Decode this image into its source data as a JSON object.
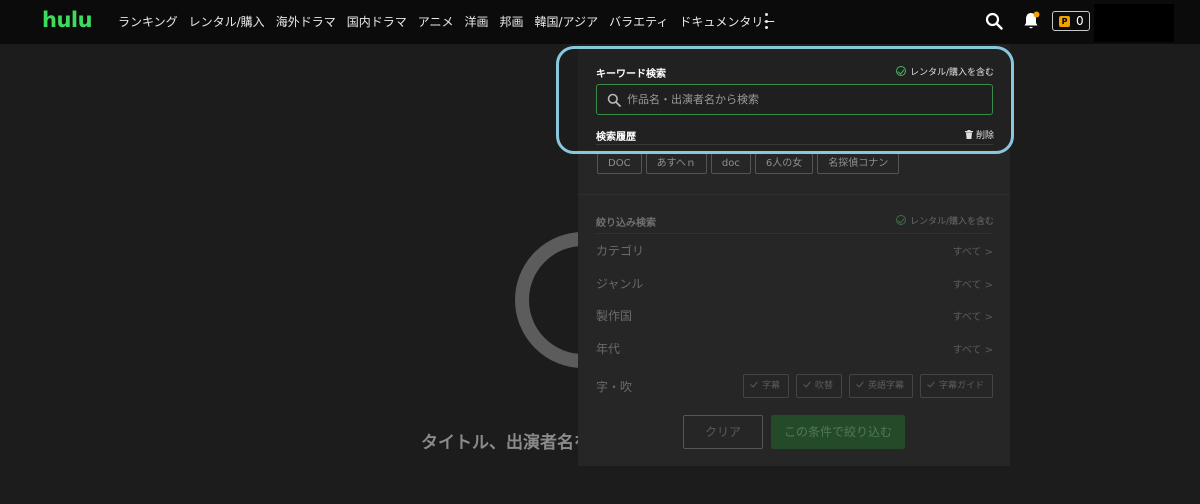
{
  "header": {
    "logo": "hulu",
    "nav_items": [
      "ランキング",
      "レンタル/購入",
      "海外ドラマ",
      "国内ドラマ",
      "アニメ",
      "洋画",
      "邦画",
      "韓国/アジア",
      "バラエティ",
      "ドキュメンタリー"
    ],
    "points": "0",
    "points_badge": "P"
  },
  "background": {
    "loading_text": "タイトル、出演者名を"
  },
  "search_panel": {
    "keyword_title": "キーワード検索",
    "rental_include": "レンタル/購入を含む",
    "search_placeholder": "作品名・出演者名から検索",
    "history_title": "検索履歴",
    "delete_label": "削除",
    "history_items": [
      "DOC",
      "あすへｎ",
      "doc",
      "6人の女",
      "名探偵コナン"
    ],
    "filter_title": "絞り込み検索",
    "filter_rental_include": "レンタル/購入を含む",
    "filters": [
      {
        "label": "カテゴリ",
        "value": "すべて >"
      },
      {
        "label": "ジャンル",
        "value": "すべて >"
      },
      {
        "label": "製作国",
        "value": "すべて >"
      },
      {
        "label": "年代",
        "value": "すべて >"
      }
    ],
    "subtitle_label": "字・吹",
    "subtitle_options": [
      "字幕",
      "吹替",
      "英語字幕",
      "字幕ガイド"
    ],
    "clear_label": "クリア",
    "apply_label": "この条件で絞り込む"
  },
  "colors": {
    "brand": "#3ddc5e",
    "highlight": "#89c7de",
    "points_badge": "#f2a200"
  }
}
